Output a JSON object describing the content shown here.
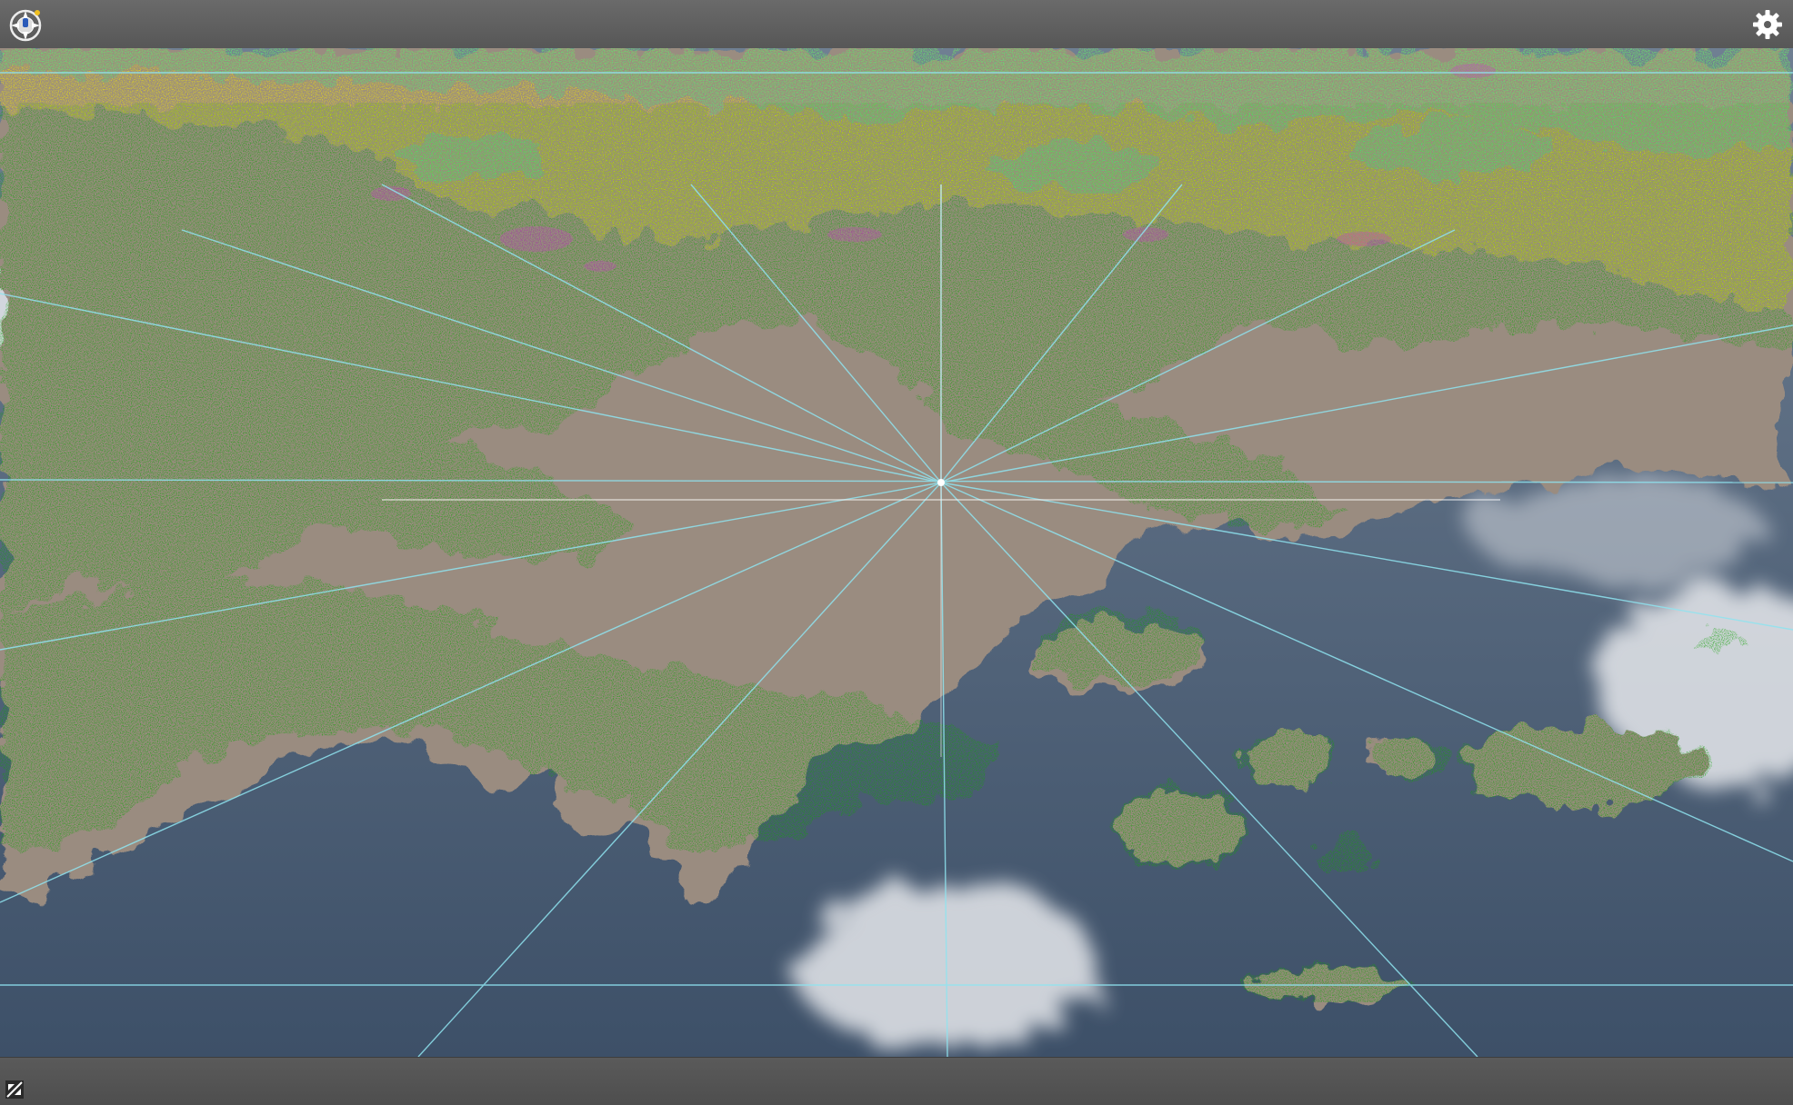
{
  "toolbar": {
    "navigator": {
      "icon": "navigation-compass-icon",
      "color": "#e8e8e8"
    },
    "settings": {
      "icon": "gear-icon",
      "color": "#ffffff"
    }
  },
  "viewport": {
    "scene": "3d-terrain-point-cloud",
    "colors": {
      "water": "#4a6078",
      "land": "#9a8c80",
      "vegetation": "#17a10f",
      "high_vegetation": "#f2e800",
      "canopy_top": "#28d6a4",
      "accent_points": "#e01ce0",
      "grid_lines": "#8fe4f0",
      "cloud": "#e6e8ec"
    }
  },
  "statusbar": {
    "tool": {
      "icon": "split-view-icon"
    }
  }
}
